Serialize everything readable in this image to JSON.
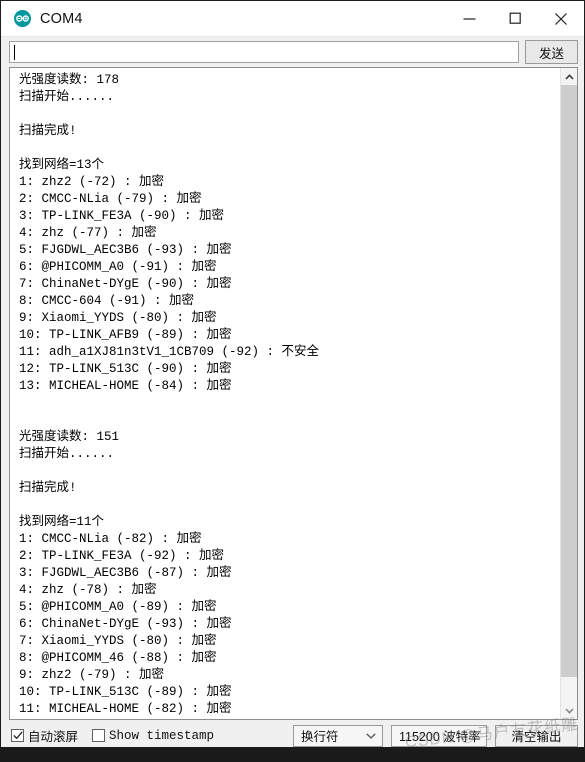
{
  "window": {
    "title": "COM4",
    "icon": "arduino-logo-icon",
    "controls": {
      "minimize": "minimize-icon",
      "maximize": "maximize-icon",
      "close": "close-icon"
    }
  },
  "send_row": {
    "input_value": "",
    "input_placeholder": "",
    "send_label": "发送"
  },
  "console": {
    "lines": [
      "光强度读数: 178",
      "扫描开始......",
      "",
      "扫描完成!",
      "",
      "找到网络=13个",
      "1: zhz2 (-72) : 加密",
      "2: CMCC-NLia (-79) : 加密",
      "3: TP-LINK_FE3A (-90) : 加密",
      "4: zhz (-77) : 加密",
      "5: FJGDWL_AEC3B6 (-93) : 加密",
      "6: @PHICOMM_A0 (-91) : 加密",
      "7: ChinaNet-DYgE (-90) : 加密",
      "8: CMCC-604 (-91) : 加密",
      "9: Xiaomi_YYDS (-80) : 加密",
      "10: TP-LINK_AFB9 (-89) : 加密",
      "11: adh_a1XJ81n3tV1_1CB709 (-92) : 不安全",
      "12: TP-LINK_513C (-90) : 加密",
      "13: MICHEAL-HOME (-84) : 加密",
      "",
      "",
      "光强度读数: 151",
      "扫描开始......",
      "",
      "扫描完成!",
      "",
      "找到网络=11个",
      "1: CMCC-NLia (-82) : 加密",
      "2: TP-LINK_FE3A (-92) : 加密",
      "3: FJGDWL_AEC3B6 (-87) : 加密",
      "4: zhz (-78) : 加密",
      "5: @PHICOMM_A0 (-89) : 加密",
      "6: ChinaNet-DYgE (-93) : 加密",
      "7: Xiaomi_YYDS (-80) : 加密",
      "8: @PHICOMM_46 (-88) : 加密",
      "9: zhz2 (-79) : 加密",
      "10: TP-LINK_513C (-89) : 加密",
      "11: MICHEAL-HOME (-82) : 加密"
    ]
  },
  "statusbar": {
    "autoscroll": {
      "label": "自动滚屏",
      "checked": true
    },
    "timestamp": {
      "label": "Show timestamp",
      "checked": false
    },
    "newline": {
      "value": "换行符"
    },
    "baud": {
      "value": "115200 波特率"
    },
    "clear_label": "清空输出"
  },
  "watermark": {
    "text": "CSDN @马户友花纸雕"
  },
  "colors": {
    "accent": "#00979c",
    "window_bg": "#f0f0f0",
    "console_bg": "#ffffff",
    "text": "#000000"
  }
}
